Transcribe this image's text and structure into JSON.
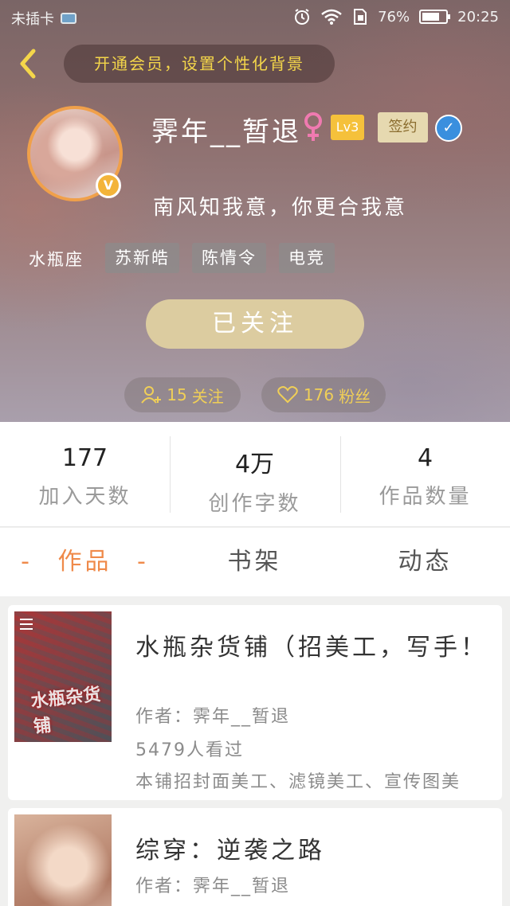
{
  "status_bar": {
    "carrier": "未插卡",
    "battery_percent": "76%",
    "battery_level": 0.76,
    "time": "20:25"
  },
  "header": {
    "vip_banner": "开通会员，设置个性化背景",
    "username": "霁年__暂退",
    "level": "Lv3",
    "sign_badge": "签约",
    "signature": "南风知我意，你更合我意",
    "zodiac": "水瓶座",
    "tags": [
      "苏新皓",
      "陈情令",
      "电竞"
    ],
    "follow_button": "已关注",
    "following_count": "15",
    "following_label": "关注",
    "fans_count": "176",
    "fans_label": "粉丝"
  },
  "stats": [
    {
      "value": "177",
      "label": "加入天数"
    },
    {
      "value": "4万",
      "label": "创作字数"
    },
    {
      "value": "4",
      "label": "作品数量"
    }
  ],
  "tabs": {
    "works": "作品",
    "shelf": "书架",
    "activity": "动态",
    "works_active_mark": "-"
  },
  "books": [
    {
      "title": "水瓶杂货铺（招美工，写手！",
      "author": "作者：霁年__暂退",
      "views": "5479人看过",
      "desc": "本铺招封面美工、滤镜美工、宣传图美",
      "cover_text": "水瓶杂货铺"
    },
    {
      "title": "综穿：逆袭之路",
      "author": "作者：霁年__暂退"
    }
  ],
  "colors": {
    "accent": "#ef8a4a",
    "gold": "#f4d64a",
    "follow_button": "#dccca0",
    "verify_blue": "#3a8fde"
  }
}
